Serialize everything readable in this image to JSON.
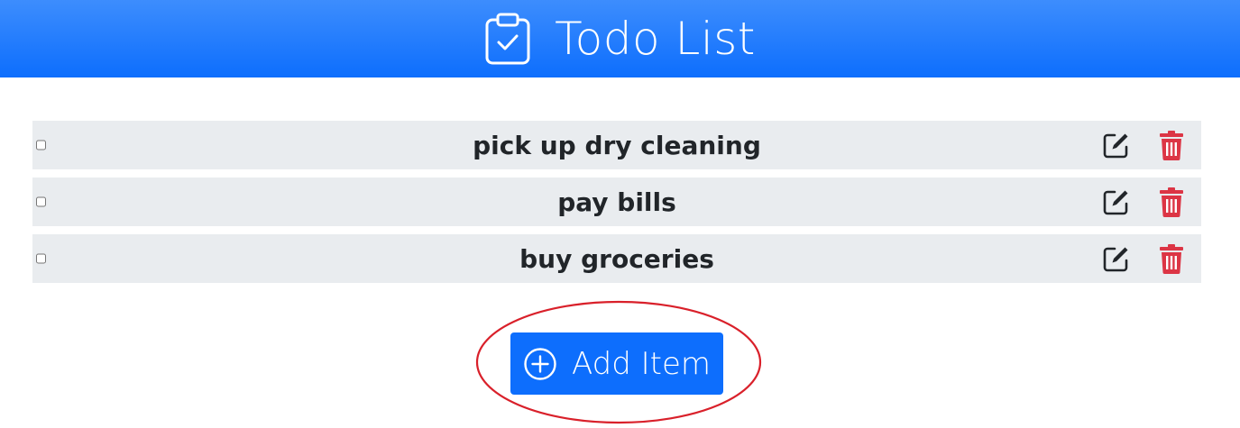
{
  "header": {
    "title": "Todo List",
    "icon": "clipboard-check-icon",
    "background": "#0d6efd"
  },
  "todos": [
    {
      "text": "pick up dry cleaning",
      "checked": false
    },
    {
      "text": "pay bills",
      "checked": false
    },
    {
      "text": "buy groceries",
      "checked": false
    }
  ],
  "row_actions": {
    "edit_icon": "pencil-square-icon",
    "delete_icon": "trash-icon",
    "delete_color": "#dc3545"
  },
  "add_button": {
    "label": "Add Item",
    "icon": "plus-circle-icon",
    "color": "#0d6efd",
    "highlight_color": "#d9202a"
  }
}
